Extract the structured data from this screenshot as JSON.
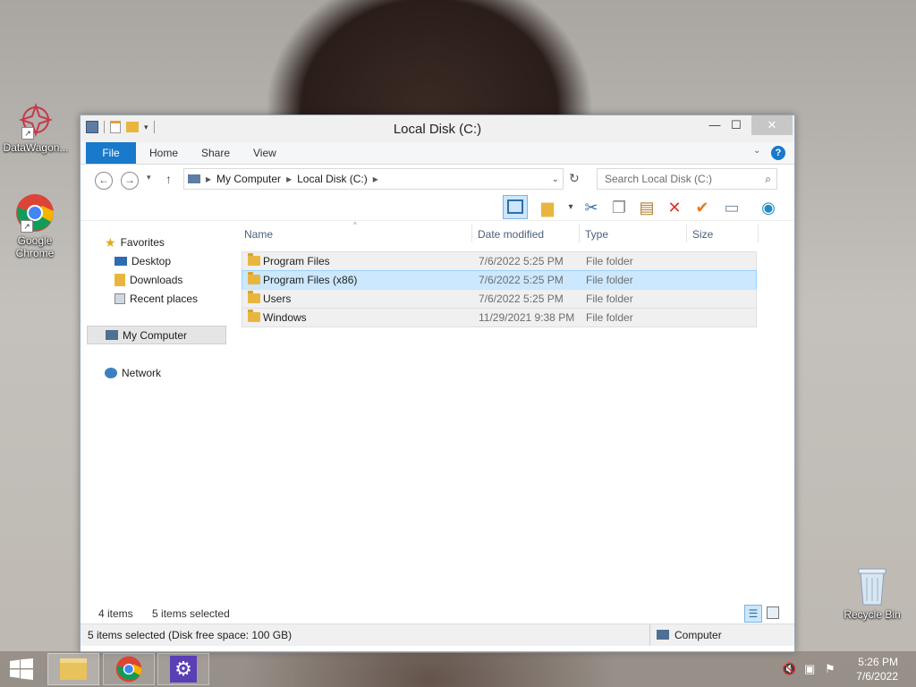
{
  "desktop": {
    "icons": [
      {
        "label": "DataWagon..."
      },
      {
        "label": "Google Chrome"
      },
      {
        "label": "Recycle Bin"
      }
    ]
  },
  "window": {
    "title": "Local Disk (C:)",
    "controls": {
      "minimize": "—",
      "maximize": "☐",
      "close": "✕"
    }
  },
  "ribbon": {
    "tabs": [
      "File",
      "Home",
      "Share",
      "View"
    ]
  },
  "address": {
    "breadcrumb": [
      "My Computer",
      "Local Disk (C:)"
    ],
    "search_placeholder": "Search Local Disk (C:)"
  },
  "nav": {
    "favorites": "Favorites",
    "favorites_items": [
      "Desktop",
      "Downloads",
      "Recent places"
    ],
    "computer": "My Computer",
    "network": "Network"
  },
  "columns": [
    "Name",
    "Date modified",
    "Type",
    "Size"
  ],
  "files": [
    {
      "name": "Program Files",
      "date": "7/6/2022 5:25 PM",
      "type": "File folder",
      "selected": false
    },
    {
      "name": "Program Files (x86)",
      "date": "7/6/2022 5:25 PM",
      "type": "File folder",
      "selected": true
    },
    {
      "name": "Users",
      "date": "7/6/2022 5:25 PM",
      "type": "File folder",
      "selected": false
    },
    {
      "name": "Windows",
      "date": "11/29/2021 9:38 PM",
      "type": "File folder",
      "selected": false
    }
  ],
  "status": {
    "items": "4 items",
    "selected": "5 items selected",
    "detail": "5 items selected (Disk free space: 100 GB)",
    "location": "Computer"
  },
  "clock": {
    "time": "5:26 PM",
    "date": "7/6/2022"
  },
  "colors": {
    "accent": "#1979ca",
    "selection": "#cce8ff",
    "folder": "#e8b640"
  }
}
